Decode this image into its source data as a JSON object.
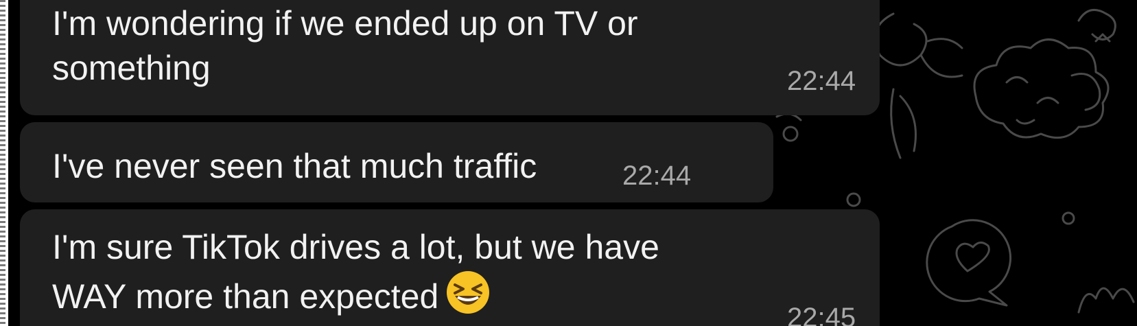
{
  "messages": [
    {
      "text_lines": [
        "I'm wondering if we ended up on TV or",
        "something"
      ],
      "time": "22:44"
    },
    {
      "text_lines": [
        "I've never seen that much traffic"
      ],
      "time": "22:44"
    },
    {
      "text_lines": [
        "I'm sure TikTok drives a lot, but we have",
        "WAY more than expected"
      ],
      "emoji": "laughing-squinting-face-emoji",
      "time": "22:45"
    }
  ],
  "colors": {
    "chat_background": "#000000",
    "bubble_background": "#1f1f1f",
    "message_text": "#f2f2f2",
    "timestamp_text": "#a9a9a9",
    "doodle_stroke": "#4a4a4a",
    "emoji_face": "#f7c325"
  }
}
